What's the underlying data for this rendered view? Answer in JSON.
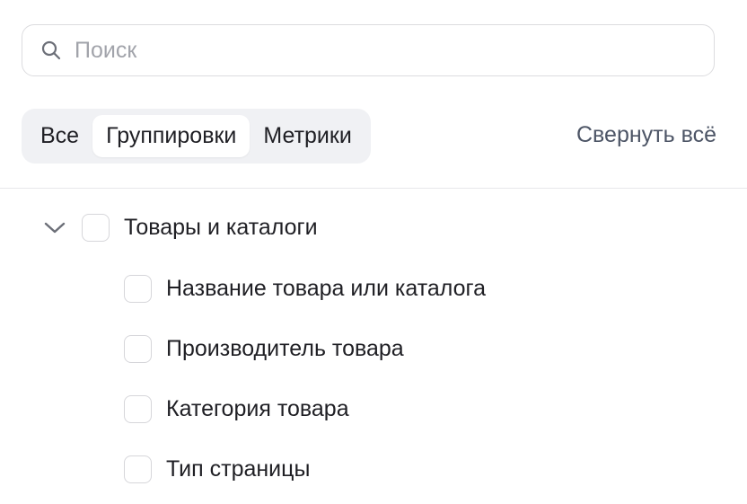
{
  "search": {
    "placeholder": "Поиск",
    "value": ""
  },
  "tabs": [
    {
      "label": "Все",
      "active": false
    },
    {
      "label": "Группировки",
      "active": true
    },
    {
      "label": "Метрики",
      "active": false
    }
  ],
  "collapse_all_label": "Свернуть всё",
  "tree": {
    "group": {
      "label": "Товары и каталоги",
      "expanded": true,
      "checked": false
    },
    "items": [
      {
        "label": "Название товара или каталога",
        "checked": false
      },
      {
        "label": "Производитель товара",
        "checked": false
      },
      {
        "label": "Категория товара",
        "checked": false
      },
      {
        "label": "Тип страницы",
        "checked": false
      }
    ]
  },
  "icons": {
    "search": "search-icon",
    "chevron": "chevron-down-icon"
  },
  "colors": {
    "text": "#1f1f24",
    "muted": "#a2a4ab",
    "link": "#4d5566",
    "tab_bg": "#f0f1f4",
    "border": "#dcdcdf"
  }
}
